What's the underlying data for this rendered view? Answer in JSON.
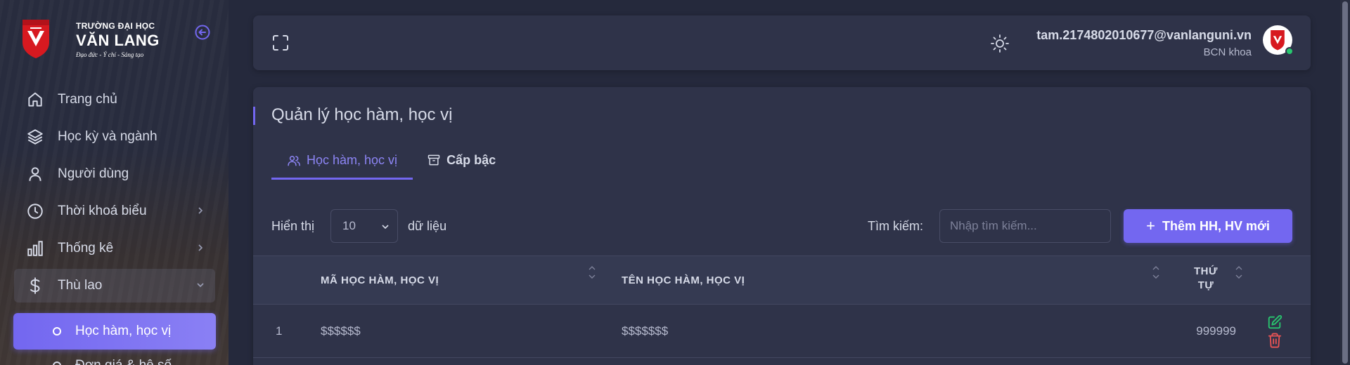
{
  "brand": {
    "line1": "TRƯỜNG ĐẠI HỌC",
    "line2": "VĂN LANG",
    "line3": "Đạo đức - Ý chí - Sáng tạo"
  },
  "sidebar": {
    "items": [
      {
        "label": "Trang chủ",
        "icon": "home-icon"
      },
      {
        "label": "Học kỳ và ngành",
        "icon": "layers-icon"
      },
      {
        "label": "Người dùng",
        "icon": "user-icon"
      },
      {
        "label": "Thời khoá biểu",
        "icon": "clock-icon"
      },
      {
        "label": "Thống kê",
        "icon": "bar-chart-icon"
      },
      {
        "label": "Thù lao",
        "icon": "dollar-icon"
      }
    ],
    "sub_active": "Học hàm, học vị",
    "sub_next": "Đơn giá & hệ số"
  },
  "topbar": {
    "email": "tam.2174802010677@vanlanguni.vn",
    "role": "BCN khoa"
  },
  "card": {
    "title": "Quản lý học hàm, học vị",
    "tabs": [
      {
        "label": "Học hàm, học vị",
        "icon": "users-icon"
      },
      {
        "label": "Cấp bậc",
        "icon": "archive-icon"
      }
    ]
  },
  "controls": {
    "show_label": "Hiển thị",
    "page_size": "10",
    "rows_label": "dữ liệu",
    "search_label": "Tìm kiếm:",
    "search_placeholder": "Nhập tìm kiếm...",
    "add_button": "Thêm HH, HV mới"
  },
  "table": {
    "columns": [
      "MÃ HỌC HÀM, HỌC VỊ",
      "TÊN HỌC HÀM, HỌC VỊ",
      "THỨ TỰ"
    ],
    "rows": [
      {
        "index": "1",
        "code": "$$$$$$",
        "name": "$$$$$$$",
        "order": "999999"
      }
    ]
  },
  "colors": {
    "accent": "#7367f0",
    "success": "#28c76f",
    "danger": "#ea5455"
  }
}
